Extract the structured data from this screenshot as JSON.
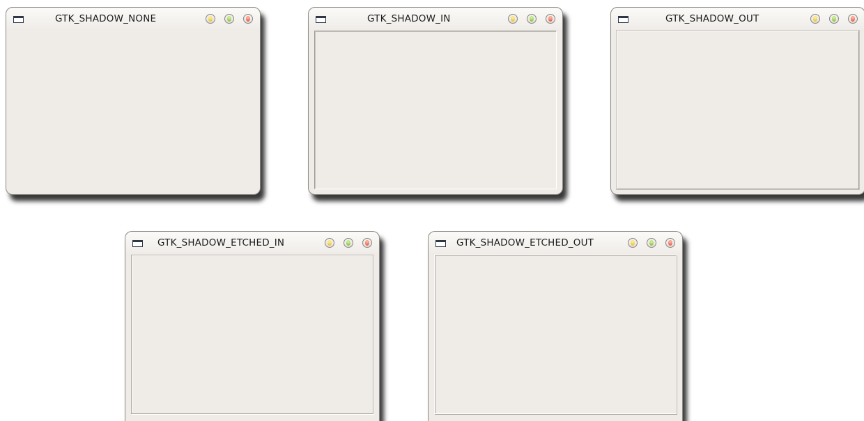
{
  "windows": [
    {
      "title": "GTK_SHADOW_NONE",
      "frame_style": "none"
    },
    {
      "title": "GTK_SHADOW_IN",
      "frame_style": "in"
    },
    {
      "title": "GTK_SHADOW_OUT",
      "frame_style": "out"
    },
    {
      "title": "GTK_SHADOW_ETCHED_IN",
      "frame_style": "etched-in"
    },
    {
      "title": "GTK_SHADOW_ETCHED_OUT",
      "frame_style": "etched-out"
    }
  ],
  "colors": {
    "window_bg": "#efece8",
    "minimize_button": "#e0b31d",
    "maximize_button": "#6fb431",
    "close_button": "#e0402c"
  },
  "icons": {
    "window_menu": "window-icon",
    "minimize": "minimize-icon",
    "maximize": "maximize-icon",
    "close": "close-icon"
  }
}
